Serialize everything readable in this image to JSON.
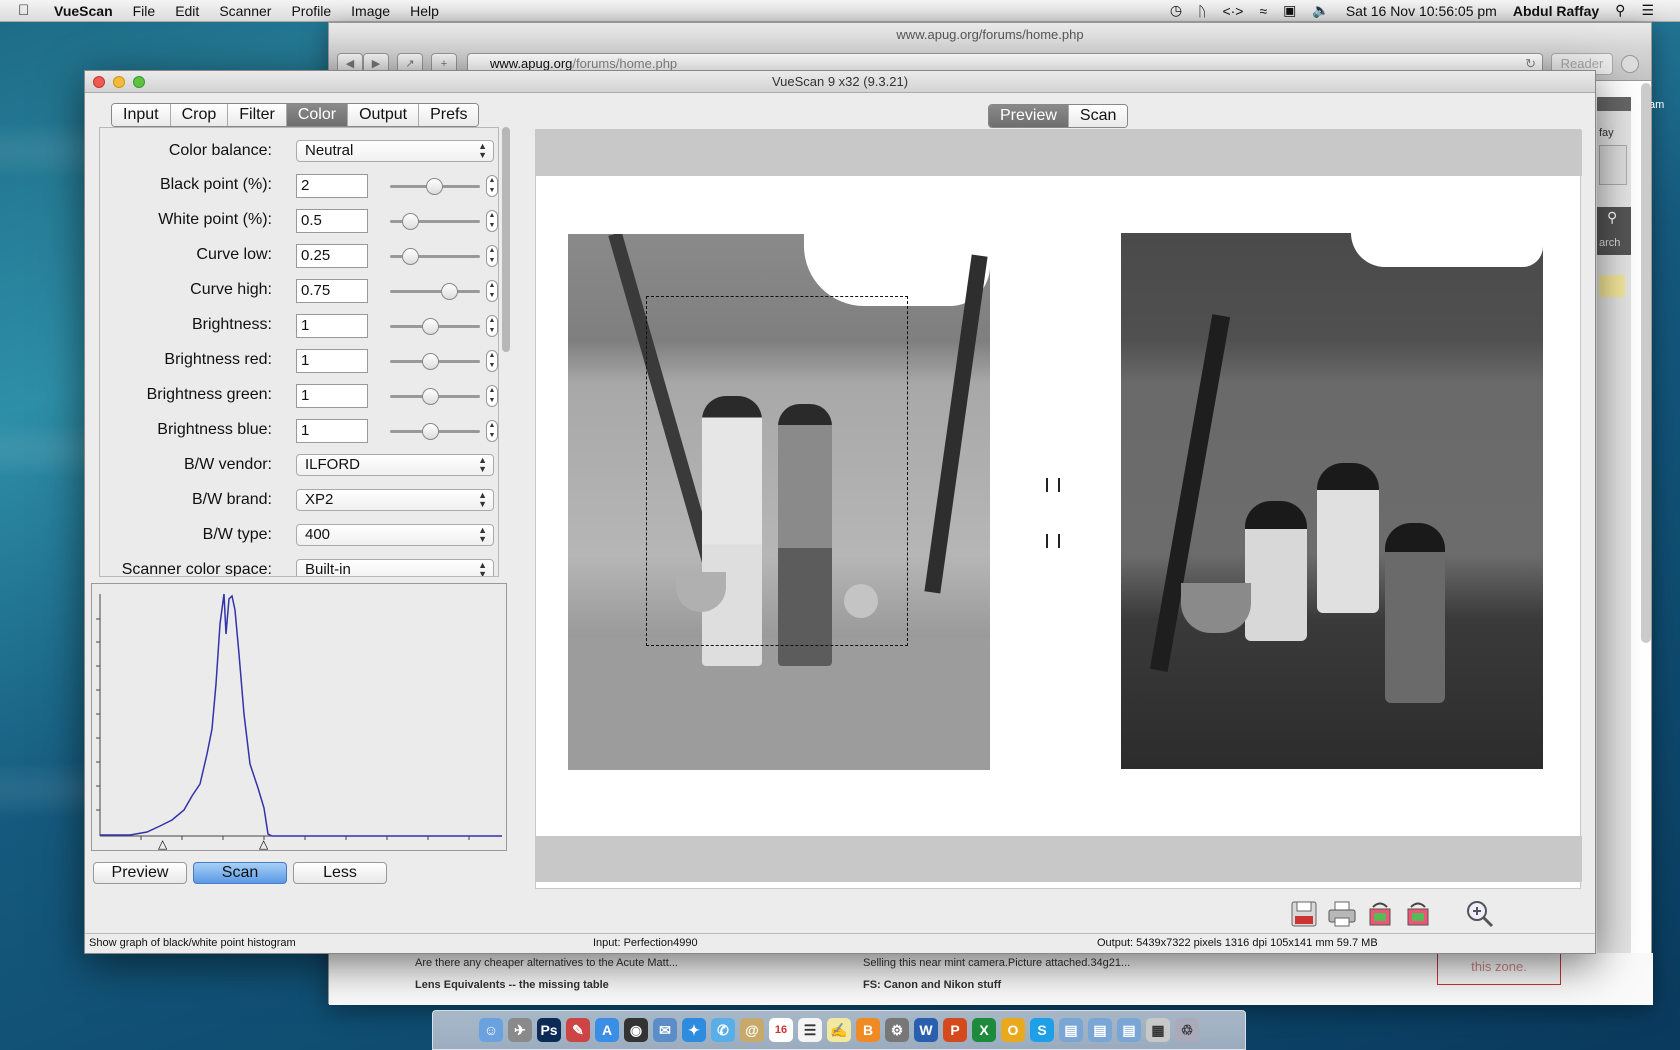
{
  "menubar": {
    "app_name": "VueScan",
    "menus": [
      "File",
      "Edit",
      "Scanner",
      "Profile",
      "Image",
      "Help"
    ],
    "datetime": "Sat 16 Nov  10:56:05 pm",
    "user": "Abdul Raffay"
  },
  "browser": {
    "title": "www.apug.org/forums/home.php",
    "url_domain": "www.apug.org",
    "url_path": "/forums/home.php",
    "reader_label": "Reader",
    "sidebar_fragments": [
      "fay",
      "am",
      "am",
      "am",
      "arch"
    ],
    "footer_rows": [
      "Are there any cheaper alternatives to the Acute Matt...",
      "Lens Equivalents -- the missing table",
      "Selling this near mint camera.Picture attached.34g21...",
      "FS: Canon and Nikon stuff",
      "this zone."
    ]
  },
  "vuescan": {
    "title": "VueScan 9 x32 (9.3.21)",
    "tabs": [
      "Input",
      "Crop",
      "Filter",
      "Color",
      "Output",
      "Prefs"
    ],
    "active_tab": "Color",
    "view_tabs": [
      "Preview",
      "Scan"
    ],
    "active_view": "Preview",
    "color_balance": {
      "label": "Color balance:",
      "value": "Neutral"
    },
    "black_point": {
      "label": "Black point (%):",
      "value": "2"
    },
    "white_point": {
      "label": "White point (%):",
      "value": "0.5"
    },
    "curve_low": {
      "label": "Curve low:",
      "value": "0.25"
    },
    "curve_high": {
      "label": "Curve high:",
      "value": "0.75"
    },
    "brightness": {
      "label": "Brightness:",
      "value": "1"
    },
    "brightness_red": {
      "label": "Brightness red:",
      "value": "1"
    },
    "brightness_green": {
      "label": "Brightness green:",
      "value": "1"
    },
    "brightness_blue": {
      "label": "Brightness blue:",
      "value": "1"
    },
    "bw_vendor": {
      "label": "B/W vendor:",
      "value": "ILFORD"
    },
    "bw_brand": {
      "label": "B/W brand:",
      "value": "XP2"
    },
    "bw_type": {
      "label": "B/W type:",
      "value": "400"
    },
    "scanner_color_space": {
      "label": "Scanner color space:",
      "value": "Built-in"
    },
    "buttons": {
      "preview": "Preview",
      "scan": "Scan",
      "less": "Less"
    },
    "status": {
      "hint": "Show graph of black/white point histogram",
      "input": "Input: Perfection4990",
      "output": "Output: 5439x7322 pixels 1316 dpi 105x141 mm 59.7 MB"
    },
    "histogram_color": "#3333aa"
  },
  "dock_apps": [
    "Finder",
    "Launchpad",
    "Photoshop",
    "Preview",
    "App Store",
    "Dashboard",
    "Mail",
    "Safari",
    "Messages",
    "Contacts",
    "Calendar",
    "Reminders",
    "Notes",
    "iBooks",
    "System Preferences",
    "Word",
    "PowerPoint",
    "Excel",
    "Outlook",
    "Skype",
    "Applications",
    "Documents",
    "Downloads",
    "Folder",
    "Trash"
  ],
  "calendar_day": "16"
}
